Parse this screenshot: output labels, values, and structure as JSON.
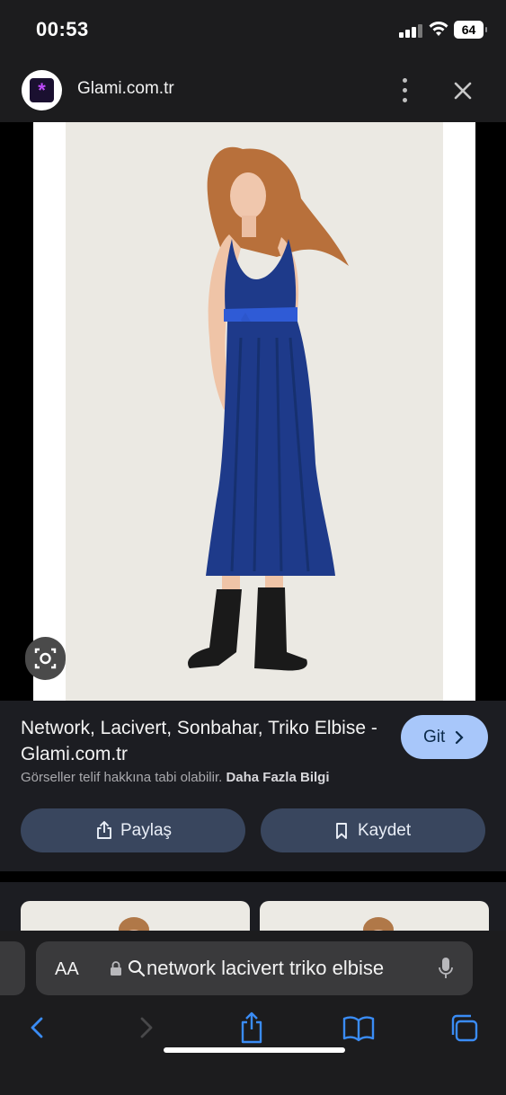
{
  "status_bar": {
    "time": "00:53",
    "battery": "64"
  },
  "header": {
    "site_name": "Glami.com.tr",
    "logo_glyph": "*"
  },
  "result": {
    "title": "Network, Lacivert, Sonbahar, Triko Elbise - Glami.com.tr",
    "visit_button": "Git",
    "copyright_notice": "Görseller telif hakkına tabi olabilir.",
    "more_info_link": "Daha Fazla Bilgi",
    "share_button": "Paylaş",
    "save_button": "Kaydet"
  },
  "address_bar": {
    "text_size_label": "AA",
    "query": "network lacivert triko elbise"
  },
  "toolbar": {
    "icons": [
      "back-icon",
      "forward-icon",
      "share-icon",
      "bookmarks-icon",
      "tabs-icon"
    ]
  },
  "colors": {
    "accent": "#a8c7fa",
    "pill": "#39465e",
    "panel": "#1c1d22",
    "dress": "#1e3a8a"
  }
}
